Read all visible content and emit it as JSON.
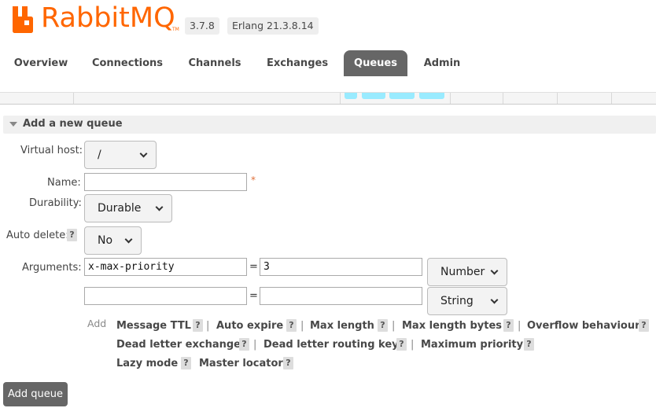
{
  "header": {
    "logo_text": "RabbitMQ",
    "logo_tm": "TM",
    "version": "3.7.8",
    "erlang": "Erlang 21.3.8.14"
  },
  "tabs": [
    {
      "label": "Overview"
    },
    {
      "label": "Connections"
    },
    {
      "label": "Channels"
    },
    {
      "label": "Exchanges"
    },
    {
      "label": "Queues",
      "active": true
    },
    {
      "label": "Admin"
    }
  ],
  "section": {
    "title": "Add a new queue"
  },
  "form": {
    "virtual_host": {
      "label": "Virtual host:",
      "value": "/"
    },
    "name": {
      "label": "Name:",
      "value": "",
      "required_mark": "*"
    },
    "durability": {
      "label": "Durability:",
      "value": "Durable"
    },
    "auto_delete": {
      "label": "Auto delete:",
      "value": "No",
      "help": "?"
    },
    "arguments": {
      "label": "Arguments:",
      "rows": [
        {
          "key": "x-max-priority",
          "value": "3",
          "type": "Number"
        },
        {
          "key": "",
          "value": "",
          "type": "String"
        }
      ],
      "eq": "="
    }
  },
  "add_links": {
    "label": "Add",
    "help": "?",
    "separator": "|",
    "items": [
      "Message TTL",
      "Auto expire",
      "Max length",
      "Max length bytes",
      "Overflow behaviour",
      "Dead letter exchange",
      "Dead letter routing key",
      "Maximum priority",
      "Lazy mode",
      "Master locator"
    ]
  },
  "submit": {
    "label": "Add queue"
  },
  "colors": {
    "brand": "#ff6600",
    "tab_active": "#666666",
    "pill": "#99ebff"
  }
}
